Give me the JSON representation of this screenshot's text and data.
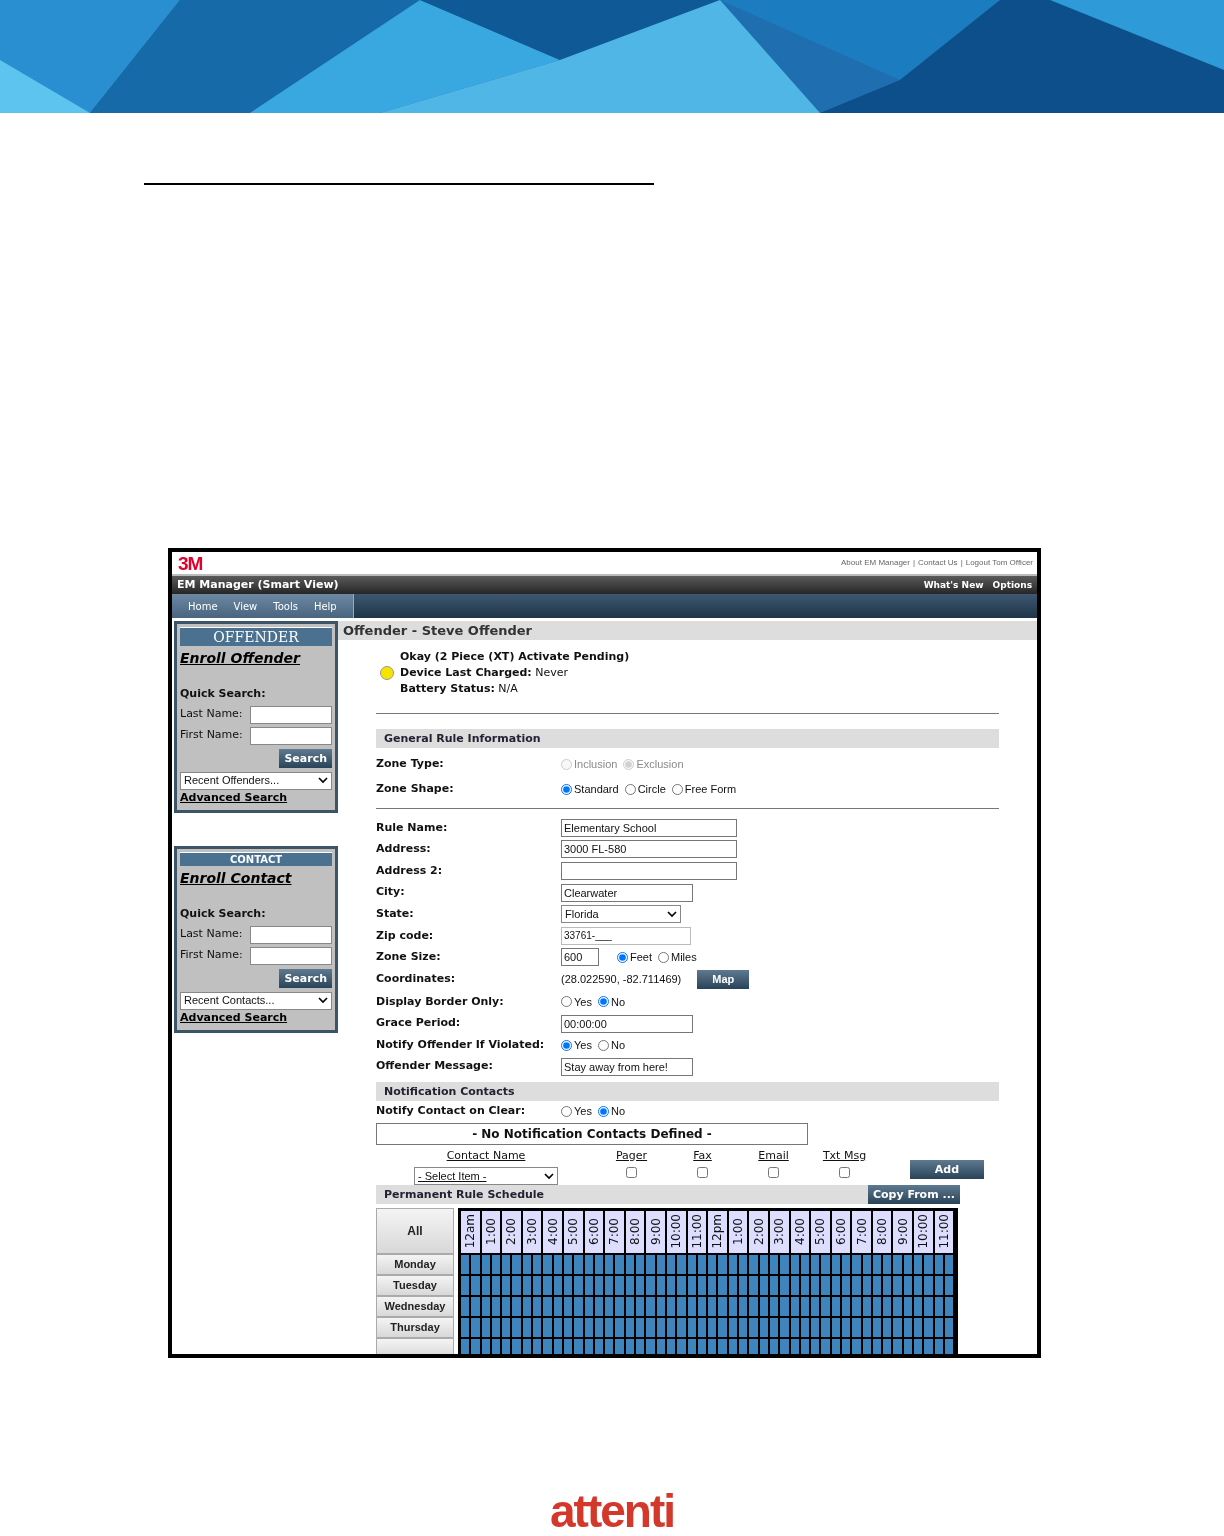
{
  "document": {
    "logo": "attenti"
  },
  "app": {
    "brand": "3M",
    "top_links": [
      "About EM Manager",
      "Contact Us",
      "Logout Tom Officer"
    ],
    "top_link_separator": "|",
    "title": "EM Manager (Smart View)",
    "title_links": [
      "What's New",
      "Options"
    ],
    "menu": [
      "Home",
      "View",
      "Tools",
      "Help"
    ],
    "sidebar": [
      {
        "kind": "large",
        "heading": "OFFENDER",
        "enroll_link": "Enroll Offender",
        "quick_search": "Quick Search:",
        "fields": [
          "Last Name:",
          "First Name:"
        ],
        "search_button": "Search",
        "recent": "Recent Offenders...",
        "advanced_link": "Advanced Search"
      },
      {
        "kind": "small",
        "heading": "CONTACT",
        "enroll_link": "Enroll Contact",
        "quick_search": "Quick Search:",
        "fields": [
          "Last Name:",
          "First Name:"
        ],
        "search_button": "Search",
        "recent": "Recent Contacts...",
        "advanced_link": "Advanced Search"
      }
    ],
    "content": {
      "title": "Offender - Steve Offender",
      "status": {
        "color": "#f5e400",
        "lines": [
          "Okay (2 Piece (XT) Activate Pending)",
          "**Device Last Charged:** Never",
          "**Battery Status:** N/A"
        ]
      },
      "general": {
        "heading": "General Rule Information",
        "zone_rows": [
          {
            "kind": "radio",
            "label": "Zone Type:",
            "disabled": true,
            "options": [
              {
                "label": "Inclusion",
                "selected": false
              },
              {
                "label": "Exclusion",
                "selected": true
              }
            ]
          },
          {
            "kind": "radio",
            "label": "Zone Shape:",
            "disabled": false,
            "options": [
              {
                "label": "Standard",
                "selected": true
              },
              {
                "label": "Circle",
                "selected": false
              },
              {
                "label": "Free Form",
                "selected": false
              }
            ]
          }
        ],
        "detail_rows": [
          {
            "kind": "input_wide",
            "label": "Rule Name:",
            "value": "Elementary School"
          },
          {
            "kind": "input_wide",
            "label": "Address:",
            "value": "3000 FL-580"
          },
          {
            "kind": "input_wide",
            "label": "Address 2:"
          },
          {
            "kind": "input_medium",
            "label": "City:",
            "value": "Clearwater"
          },
          {
            "kind": "select",
            "label": "State:",
            "value": "Florida"
          },
          {
            "kind": "masked",
            "label": "Zip code:",
            "value": "33761-___"
          },
          {
            "kind": "input_radio",
            "label": "Zone Size:",
            "value": "600",
            "options": [
              {
                "label": "Feet",
                "selected": true
              },
              {
                "label": "Miles",
                "selected": false
              }
            ]
          },
          {
            "kind": "text_button",
            "label": "Coordinates:",
            "text": "(28.022590, -82.711469)",
            "button": "Map"
          },
          {
            "kind": "radio",
            "label": "Display Border Only:",
            "options": [
              {
                "label": "Yes",
                "selected": false
              },
              {
                "label": "No",
                "selected": true
              }
            ]
          },
          {
            "kind": "input_medium",
            "label": "Grace Period:",
            "value": "00:00:00"
          },
          {
            "kind": "radio",
            "label": "Notify Offender If Violated:",
            "options": [
              {
                "label": "Yes",
                "selected": true
              },
              {
                "label": "No",
                "selected": false
              }
            ]
          },
          {
            "kind": "input_medium",
            "label": "Offender Message:",
            "value": "Stay away from here!"
          }
        ]
      },
      "notification": {
        "heading": "Notification Contacts",
        "rows": [
          {
            "kind": "radio",
            "label": "Notify Contact on Clear:",
            "options": [
              {
                "label": "Yes",
                "selected": false
              },
              {
                "label": "No",
                "selected": true
              }
            ]
          }
        ],
        "empty_message": "- No Notification Contacts Defined -",
        "columns": [
          {
            "kind": "select",
            "label": "Contact Name",
            "value": "- Select Item -"
          },
          {
            "kind": "checkbox",
            "label": "Pager",
            "checked": false
          },
          {
            "kind": "checkbox",
            "label": "Fax",
            "checked": false
          },
          {
            "kind": "checkbox",
            "label": "Email",
            "checked": false
          },
          {
            "kind": "checkbox",
            "label": "Txt Msg",
            "checked": false
          }
        ],
        "add_button": "Add"
      },
      "schedule": {
        "heading": "Permanent Rule Schedule",
        "copy_button": "Copy From ...",
        "all_button": "All",
        "hours": [
          "12am",
          "1:00",
          "2:00",
          "3:00",
          "4:00",
          "5:00",
          "6:00",
          "7:00",
          "8:00",
          "9:00",
          "10:00",
          "11:00",
          "12pm",
          "1:00",
          "2:00",
          "3:00",
          "4:00",
          "5:00",
          "6:00",
          "7:00",
          "8:00",
          "9:00",
          "10:00",
          "11:00"
        ],
        "rows": [
          {
            "day": "Monday",
            "active": true
          },
          {
            "day": "Tuesday",
            "active": true
          },
          {
            "day": "Wednesday",
            "active": true
          },
          {
            "day": "Thursday",
            "active": true
          },
          {
            "active": true
          }
        ]
      }
    }
  }
}
